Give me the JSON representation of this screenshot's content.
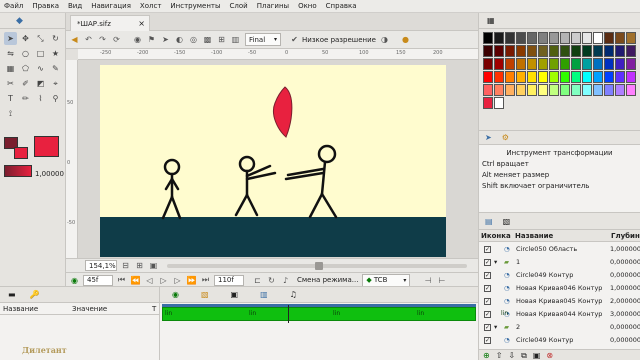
{
  "menu": [
    "Файл",
    "Правка",
    "Вид",
    "Навигация",
    "Холст",
    "Инструменты",
    "Слой",
    "Плагины",
    "Окно",
    "Справка"
  ],
  "document": {
    "tab_title": "*ШАР.sifz",
    "render_mode": "Final",
    "low_res_label": "Низкое разрешение"
  },
  "ruler": {
    "h_labels": [
      "-250",
      "-200",
      "-150",
      "-100",
      "-50",
      "0",
      "50",
      "100",
      "150",
      "200"
    ],
    "v_labels": [
      "50",
      "0",
      "-50"
    ]
  },
  "colors": {
    "outline": "#7a1e2e",
    "fill": "#e8213f",
    "sky": "#fffccf",
    "ground": "#0f3c48",
    "balloon": "#e8213f",
    "track": "#0fbf0f"
  },
  "brush_size": "1,00000",
  "status": {
    "zoom": "154,1%",
    "mode_label": "Смена режима..."
  },
  "time": {
    "current_frame": "45f",
    "end_frame": "110f",
    "interpolation": "TCB"
  },
  "palette_colors": [
    "#000000",
    "#1a1a1a",
    "#333333",
    "#4d4d4d",
    "#666666",
    "#808080",
    "#999999",
    "#b3b3b3",
    "#cccccc",
    "#e6e6e6",
    "#ffffff",
    "#5a2c12",
    "#7a4a1c",
    "#a0702c",
    "#3a0000",
    "#5a0000",
    "#7a1a00",
    "#8a3a00",
    "#805010",
    "#706020",
    "#506010",
    "#305010",
    "#104010",
    "#003a20",
    "#003a50",
    "#002a70",
    "#201a70",
    "#401a60",
    "#7a0000",
    "#a00000",
    "#c04000",
    "#c07000",
    "#c09000",
    "#a0a000",
    "#70a000",
    "#30a000",
    "#00a040",
    "#00a0a0",
    "#0070c0",
    "#0030c0",
    "#4020c0",
    "#8020a0",
    "#ff0000",
    "#ff3000",
    "#ff8000",
    "#ffb000",
    "#ffe000",
    "#ffff00",
    "#a0ff00",
    "#30ff00",
    "#00ff80",
    "#00ffff",
    "#00a0ff",
    "#0040ff",
    "#6030ff",
    "#c030ff",
    "#ff6060",
    "#ff8060",
    "#ffb060",
    "#ffd060",
    "#fff060",
    "#ffff80",
    "#c0ff80",
    "#80ff80",
    "#80ffc0",
    "#80ffff",
    "#80c0ff",
    "#8080ff",
    "#b080ff",
    "#ff80ff",
    "#e8213f",
    "#ffffff"
  ],
  "tool_options": {
    "title": "Инструмент трансформации",
    "lines": [
      "Ctrl вращает",
      "Alt меняет размер",
      "Shift включает ограничитель"
    ]
  },
  "layers": {
    "col_icon": "Иконка",
    "col_name": "Название",
    "col_depth": "Глубина",
    "rows": [
      {
        "name": "Circle050 Область",
        "depth": "1,000000",
        "expand": ""
      },
      {
        "name": "1",
        "depth": "0,000000",
        "expand": "▾"
      },
      {
        "name": "Circle049 Контур",
        "depth": "0,000000",
        "expand": ""
      },
      {
        "name": "Новая Кривая046 Контур",
        "depth": "1,000000",
        "expand": ""
      },
      {
        "name": "Новая Кривая045 Контур",
        "depth": "2,000000",
        "expand": ""
      },
      {
        "name": "Новая Кривая044 Контур",
        "depth": "3,000000",
        "expand": ""
      },
      {
        "name": "2",
        "depth": "0,000000",
        "expand": "▾"
      },
      {
        "name": "Circle049 Контур",
        "depth": "0,000000",
        "expand": ""
      }
    ]
  },
  "params": {
    "col_name": "Название",
    "col_value": "Значение",
    "col_type": "Т"
  },
  "timetrack": {
    "keyframe_labels": [
      "lin",
      "lin",
      "lin",
      "lin",
      "lin"
    ]
  },
  "watermark": "Дилетант"
}
